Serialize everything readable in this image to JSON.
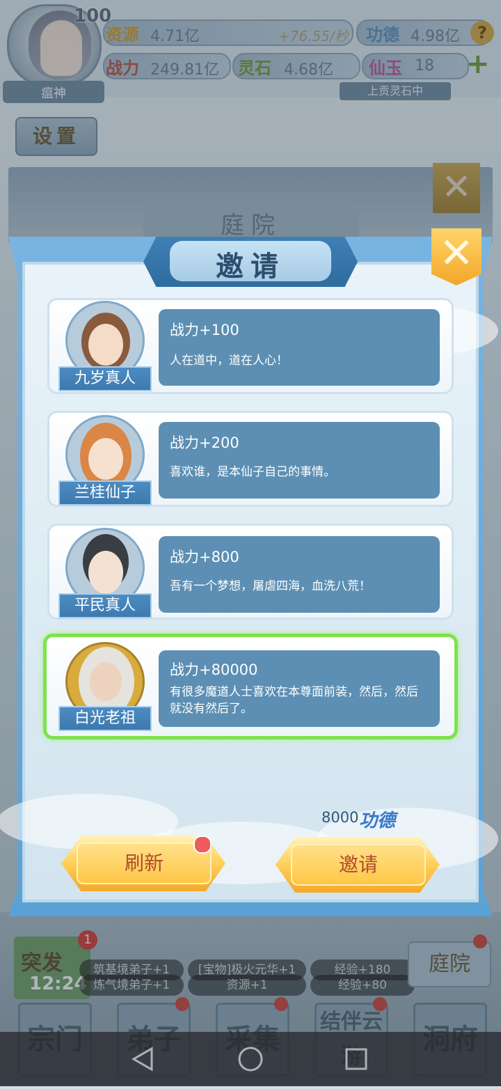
{
  "hud": {
    "level": "100",
    "player_name": "瘟神",
    "resources": {
      "res1_label": "资源",
      "res1_value": "4.71亿",
      "res1_rate": "+76.55/秒",
      "merit_label": "功德",
      "merit_value": "4.98亿",
      "power_label": "战力",
      "power_value": "249.81亿",
      "spirit_label": "灵石",
      "spirit_value": "4.68亿",
      "jade_label": "仙玉",
      "jade_value": "18"
    },
    "status_tag": "上贡灵石中",
    "help_label": "?",
    "add_label": "+",
    "settings_label": "设置"
  },
  "back_dialog": {
    "title": "庭院",
    "close_label": "✕"
  },
  "bottom": {
    "event_label": "突发",
    "event_time": "12:24",
    "event_badge": "1",
    "logs": [
      {
        "a": "筑基境弟子+1",
        "b": "[宝物]极火元华+1",
        "c": "经验+180"
      },
      {
        "a": "炼气境弟子+1",
        "b": "资源+1",
        "c": "经验+80"
      }
    ],
    "court_label": "庭院",
    "nav": [
      "宗门",
      "弟子",
      "采集",
      "结伴云游",
      "洞府"
    ]
  },
  "dialog": {
    "title": "邀请",
    "close_label": "✕",
    "candidates": [
      {
        "name": "九岁真人",
        "power": "战力+100",
        "quote": "人在道中，道在人心！"
      },
      {
        "name": "兰桂仙子",
        "power": "战力+200",
        "quote": "喜欢谁，是本仙子自己的事情。"
      },
      {
        "name": "平民真人",
        "power": "战力+800",
        "quote": "吾有一个梦想，屠虐四海，血洗八荒！"
      },
      {
        "name": "白光老祖",
        "power": "战力+80000",
        "quote": "有很多魔道人士喜欢在本尊面前装，然后，然后就没有然后了。"
      }
    ],
    "cost_value": "8000",
    "cost_label": "功德",
    "refresh_label": "刷新",
    "invite_label": "邀请"
  },
  "colors": {
    "accent_blue": "#5c8fb3",
    "selected_border": "#7ee24e",
    "gold": "#ffd35e"
  }
}
